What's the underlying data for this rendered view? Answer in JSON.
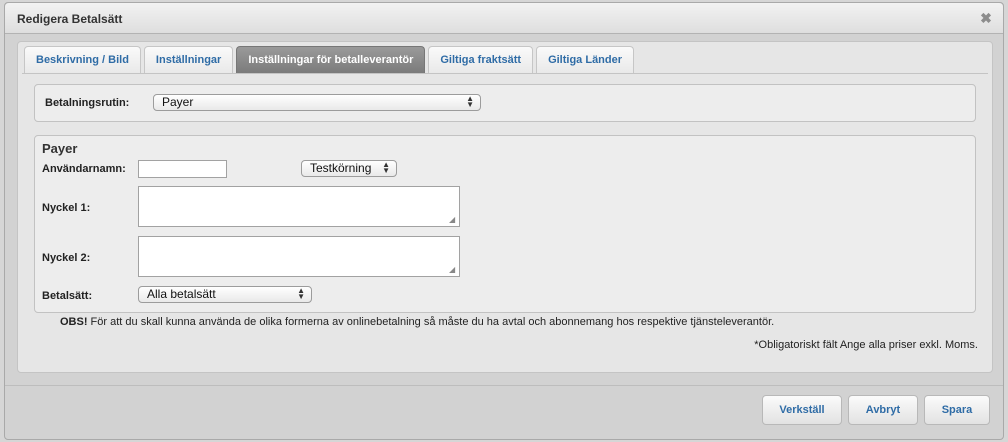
{
  "window": {
    "title": "Redigera Betalsätt",
    "close_symbol": "✖"
  },
  "tabs": [
    {
      "label": "Beskrivning / Bild"
    },
    {
      "label": "Inställningar"
    },
    {
      "label": "Inställningar för betalleverantör"
    },
    {
      "label": "Giltiga fraktsätt"
    },
    {
      "label": "Giltiga Länder"
    }
  ],
  "form": {
    "routine_label": "Betalningsrutin:",
    "routine_value": "Payer",
    "section_title": "Payer",
    "username_label": "Användarnamn:",
    "username_value": "",
    "mode_value": "Testkörning",
    "key1_label": "Nyckel 1:",
    "key2_label": "Nyckel 2:",
    "methods_label": "Betalsätt:",
    "methods_value": "Alla betalsätt"
  },
  "notes": {
    "obs_prefix": "OBS!",
    "obs_text": " För att du skall kunna använda de olika formerna av onlinebetalning så måste du ha avtal och abonnemang hos respektive tjänsteleverantör.",
    "required": "*Obligatoriskt fält Ange alla priser exkl. Moms."
  },
  "buttons": {
    "reset": "Verkställ",
    "cancel": "Avbryt",
    "save": "Spara"
  }
}
